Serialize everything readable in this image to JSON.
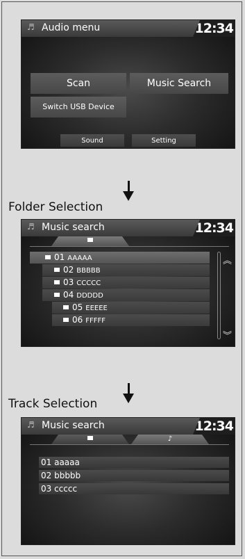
{
  "audio_menu": {
    "title": "Audio menu",
    "clock": "12:34",
    "buttons": {
      "scan": "Scan",
      "music_search": "Music Search",
      "switch_usb": "Switch USB Device",
      "sound": "Sound",
      "setting": "Setting"
    }
  },
  "labels": {
    "folder_selection": "Folder Selection",
    "track_selection": "Track Selection"
  },
  "folder_screen": {
    "title": "Music search",
    "clock": "12:34",
    "folders": [
      {
        "num": "01",
        "name": "AAAAA"
      },
      {
        "num": "02",
        "name": "BBBBB"
      },
      {
        "num": "03",
        "name": "CCCCC"
      },
      {
        "num": "04",
        "name": "DDDDD"
      },
      {
        "num": "05",
        "name": "EEEEE"
      },
      {
        "num": "06",
        "name": "FFFFF"
      }
    ],
    "icons": [
      "music-note-icon",
      "folder-icon",
      "scroll-up-icon",
      "scroll-down-icon"
    ]
  },
  "track_screen": {
    "title": "Music search",
    "clock": "12:34",
    "tracks": [
      "01 aaaaa",
      "02 bbbbb",
      "03 ccccc"
    ],
    "icons": [
      "music-note-icon",
      "folder-icon"
    ]
  }
}
